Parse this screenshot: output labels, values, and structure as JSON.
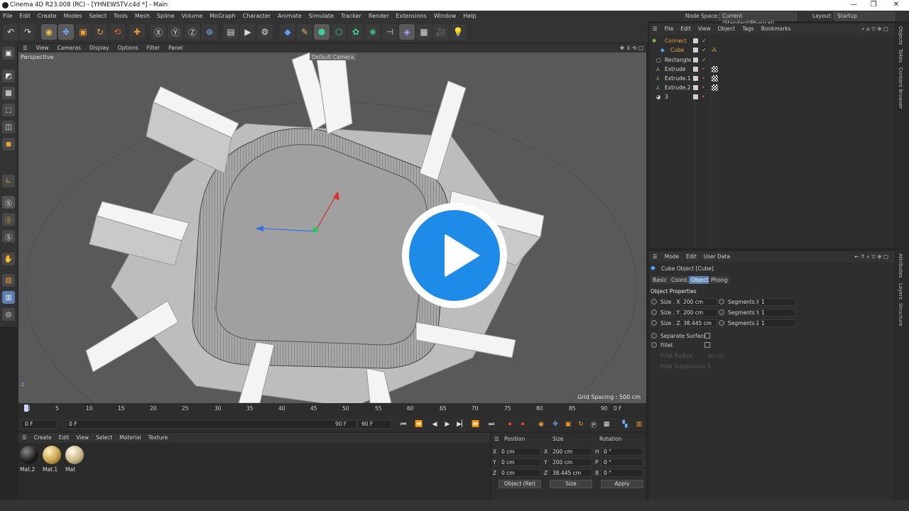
{
  "window": {
    "title": "Cinema 4D R23.008 (RC) - [YHNEWSTV.c4d *] - Main",
    "controls": [
      "—",
      "❐",
      "✕"
    ]
  },
  "menu": {
    "items": [
      "File",
      "Edit",
      "Create",
      "Modes",
      "Select",
      "Tools",
      "Mesh",
      "Spline",
      "Volume",
      "MoGraph",
      "Character",
      "Animate",
      "Simulate",
      "Tracker",
      "Render",
      "Extensions",
      "Window",
      "Help"
    ],
    "node_space_label": "Node Space:",
    "node_space_value": "Current (Standard/Physical)",
    "layout_label": "Layout:",
    "layout_value": "Startup"
  },
  "viewport": {
    "menu": [
      "View",
      "Cameras",
      "Display",
      "Options",
      "Filter",
      "Panel"
    ],
    "label": "Perspective",
    "camera": "Default Camera",
    "grid_spacing": "Grid Spacing : 500 cm"
  },
  "timeline": {
    "ticks": [
      "0",
      "5",
      "10",
      "15",
      "20",
      "25",
      "30",
      "35",
      "40",
      "45",
      "50",
      "55",
      "60",
      "65",
      "70",
      "75",
      "80",
      "85",
      "90"
    ],
    "current_frame": "0 F",
    "start": "0 F",
    "preview_start": "0 F",
    "end": "90 F",
    "preview_end": "90 F"
  },
  "materials": {
    "menu": [
      "Create",
      "Edit",
      "View",
      "Select",
      "Material",
      "Texture"
    ],
    "items": [
      {
        "name": "Mat.2",
        "color": "#1a1a1a"
      },
      {
        "name": "Mat.1",
        "color": "#c9a24e"
      },
      {
        "name": "Mat",
        "color": "#c8b88a"
      }
    ]
  },
  "coordinates": {
    "headers": [
      "Position",
      "Size",
      "Rotation"
    ],
    "rows": [
      {
        "axis": "X",
        "pos": "0 cm",
        "saxis": "X",
        "size": "200 cm",
        "raxis": "H",
        "rot": "0 °"
      },
      {
        "axis": "Y",
        "pos": "0 cm",
        "saxis": "Y",
        "size": "200 cm",
        "raxis": "P",
        "rot": "0 °"
      },
      {
        "axis": "Z",
        "pos": "0 cm",
        "saxis": "Z",
        "size": "38.445 cm",
        "raxis": "B",
        "rot": "0 °"
      }
    ],
    "mode": "Object (Rel)",
    "size_mode": "Size",
    "apply": "Apply"
  },
  "objects": {
    "menu": [
      "File",
      "Edit",
      "View",
      "Object",
      "Tags",
      "Bookmarks"
    ],
    "items": [
      {
        "name": "Connect",
        "color": "#e0a040"
      },
      {
        "name": "Cube",
        "color": "#e0a040"
      },
      {
        "name": "Rectangle",
        "color": "#d6d6d6"
      },
      {
        "name": "Extrude",
        "color": "#d6d6d6"
      },
      {
        "name": "Extrude.1",
        "color": "#d6d6d6"
      },
      {
        "name": "Extrude.2",
        "color": "#d6d6d6"
      },
      {
        "name": "3",
        "color": "#d6d6d6"
      }
    ]
  },
  "attributes": {
    "menu": [
      "Mode",
      "Edit",
      "User Data"
    ],
    "object_title": "Cube Object [Cube]",
    "tabs": [
      "Basic",
      "Coord.",
      "Object",
      "Phong"
    ],
    "active_tab": "Object",
    "section": "Object Properties",
    "size_x_label": "Size . X",
    "size_x": "200 cm",
    "size_y_label": "Size . Y",
    "size_y": "200 cm",
    "size_z_label": "Size . Z",
    "size_z": "38.445 cm",
    "seg_x_label": "Segments X",
    "seg_x": "1",
    "seg_y_label": "Segments Y",
    "seg_y": "1",
    "seg_z_label": "Segments Z",
    "seg_z": "1",
    "separate_surfaces": "Separate Surfaces",
    "fillet": "Fillet",
    "fillet_radius": "Fillet Radius",
    "fillet_radius_value": "40 cm",
    "fillet_subdivision": "Fillet Subdivision",
    "fillet_subdivision_value": "5"
  },
  "side_tabs": [
    "Objects",
    "Takes",
    "Content Browser"
  ],
  "side_tabs_lower": [
    "Attributes",
    "Layers",
    "Structure"
  ]
}
